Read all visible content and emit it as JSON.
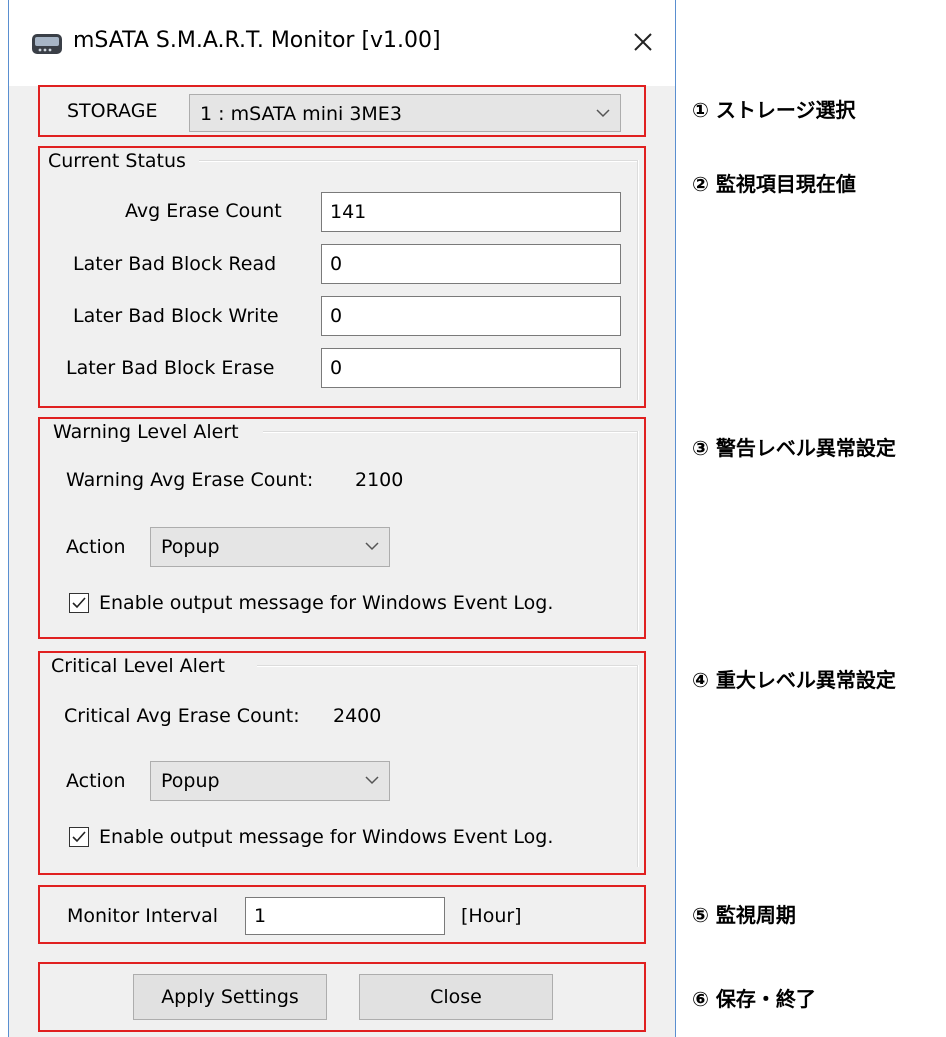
{
  "window": {
    "title": "mSATA S.M.A.R.T. Monitor [v1.00]"
  },
  "storage": {
    "label": "STORAGE",
    "selected": "1 : mSATA mini 3ME3"
  },
  "current_status": {
    "legend": "Current Status",
    "avg_erase_count": {
      "label": "Avg Erase Count",
      "value": "141"
    },
    "bad_block_read": {
      "label": "Later Bad Block Read",
      "value": "0"
    },
    "bad_block_write": {
      "label": "Later Bad Block Write",
      "value": "0"
    },
    "bad_block_erase": {
      "label": "Later Bad Block Erase",
      "value": "0"
    }
  },
  "warning": {
    "legend": "Warning Level Alert",
    "count_label": "Warning Avg Erase Count:",
    "count_value": "2100",
    "action_label": "Action",
    "action_value": "Popup",
    "eventlog_label": "Enable output message for Windows Event Log.",
    "eventlog_checked": true
  },
  "critical": {
    "legend": "Critical Level Alert",
    "count_label": "Critical Avg Erase Count:",
    "count_value": "2400",
    "action_label": "Action",
    "action_value": "Popup",
    "eventlog_label": "Enable output message for Windows Event Log.",
    "eventlog_checked": true
  },
  "monitor": {
    "label": "Monitor Interval",
    "value": "1",
    "unit": "[Hour]"
  },
  "buttons": {
    "apply": "Apply Settings",
    "close": "Close"
  },
  "annotations": [
    "① ストレージ選択",
    "② 監視項目現在値",
    "③ 警告レベル異常設定",
    "④ 重大レベル異常設定",
    "⑤ 監視周期",
    "⑥ 保存・終了"
  ],
  "colors": {
    "highlight_border": "#e02020",
    "window_bg": "#f0f0f0",
    "frame": "#5a8fd0"
  },
  "icons": [
    "drive-icon",
    "close-icon",
    "chevron-down-icon",
    "checkmark-icon"
  ]
}
